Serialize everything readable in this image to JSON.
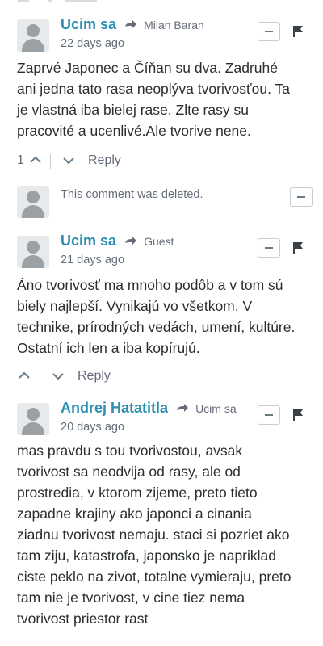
{
  "comments": [
    {
      "author": "Ucim sa",
      "reply_to": "Milan Baran",
      "time": "22 days ago",
      "lines": [
        "Zaprvé Japonec a Číňan su dva. Zadruhé",
        "ani jedna tato rasa neoplýva tvorivosťou. Ta",
        "je vlastná iba bielej rase. Zlte rasy su",
        "pracovité a ucenlivé.Ale tvorive nene."
      ],
      "upvotes": "1",
      "reply_label": "Reply"
    },
    {
      "deleted_text": "This comment was deleted."
    },
    {
      "author": "Ucim sa",
      "reply_to": "Guest",
      "time": "21 days ago",
      "lines": [
        "Áno tvorivosť ma mnoho podôb a v tom sú",
        "biely najlepší. Vynikajú vo všetkom. V",
        "technike, prírodných vedách, umení, kultúre.",
        "Ostatní ich len a iba kopírujú."
      ],
      "reply_label": "Reply"
    },
    {
      "author": "Andrej Hatatitla",
      "reply_to": "Ucim sa",
      "time": "20 days ago",
      "lines": [
        "mas pravdu s tou tvorivostou, avsak",
        "tvorivost sa neodvija od rasy, ale od",
        "prostredia, v ktorom zijeme, preto tieto",
        "zapadne krajiny ako japonci a cinania",
        "ziadnu tvorivost nemaju. staci si pozriet ako",
        "tam ziju, katastrofa, japonsko je napriklad",
        "ciste peklo na zivot, totalne vymieraju, preto",
        "tam nie je tvorivost, v cine tiez nema",
        "tvorivost priestor rast"
      ]
    }
  ],
  "icons": {
    "avatar": "user-avatar-placeholder",
    "reply_arrow": "reply-arrow-icon",
    "minimize": "minimize-icon",
    "flag": "flag-icon",
    "upvote": "chevron-up-icon",
    "downvote": "chevron-down-icon"
  },
  "colors": {
    "author": "#2e8fb2",
    "meta": "#656c7a",
    "text": "#2a2e2e",
    "divider": "#d8dcde"
  }
}
